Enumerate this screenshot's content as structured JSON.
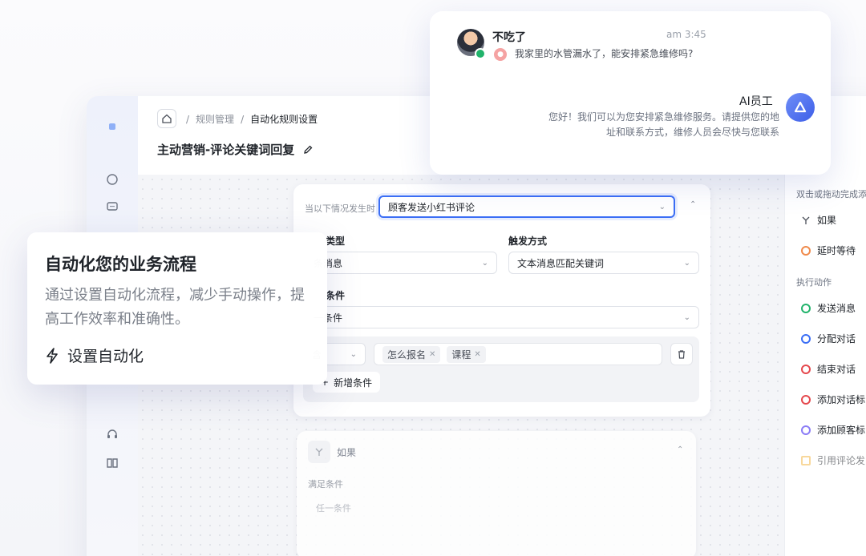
{
  "breadcrumb": {
    "home_icon": "home-icon",
    "item1": "规则管理",
    "sep": "/",
    "item2": "自动化规则设置"
  },
  "page": {
    "title": "主动营销-评论关键词回复"
  },
  "trigger": {
    "when_label": "当以下情况发生时",
    "when_value": "顾客发送小红书评论",
    "type_label": "类型",
    "type_value": "条消息",
    "mode_label": "触发方式",
    "mode_value": "文本消息匹配关键词",
    "cond_label": "条件",
    "cond_value": "一条件",
    "op_value": "含",
    "tags": [
      "怎么报名",
      "课程"
    ],
    "add_condition": "新增条件"
  },
  "if_block": {
    "label": "如果",
    "satisfy": "满足条件",
    "any": "任一条件"
  },
  "right_panel": {
    "hint": "双击或拖动完成添加",
    "logic": [
      {
        "label": "如果",
        "icon": "branch-icon"
      },
      {
        "label": "延时等待",
        "icon": "clock-icon"
      }
    ],
    "actions_title": "执行动作",
    "actions": [
      {
        "label": "发送消息",
        "color": "#21b36b"
      },
      {
        "label": "分配对话",
        "color": "#3b6ef5"
      },
      {
        "label": "结束对话",
        "color": "#e5484d"
      },
      {
        "label": "添加对话标",
        "color": "#e5484d"
      },
      {
        "label": "添加顾客标",
        "color": "#8b7cf6"
      },
      {
        "label": "引用评论发",
        "color": "#f2b84b"
      }
    ]
  },
  "chat": {
    "customer_name": "不吃了",
    "time": "am 3:45",
    "customer_msg": "我家里的水管漏水了，能安排紧急维修吗?",
    "ai_name": "AI员工",
    "ai_msg": "您好！我们可以为您安排紧急维修服务。请提供您的地址和联系方式，维修人员会尽快与您联系"
  },
  "feature": {
    "title": "自动化您的业务流程",
    "desc": "通过设置自动化流程，减少手动操作，提高工作效率和准确性。",
    "cta": "设置自动化"
  },
  "colors": {
    "accent": "#3b6ef5"
  }
}
